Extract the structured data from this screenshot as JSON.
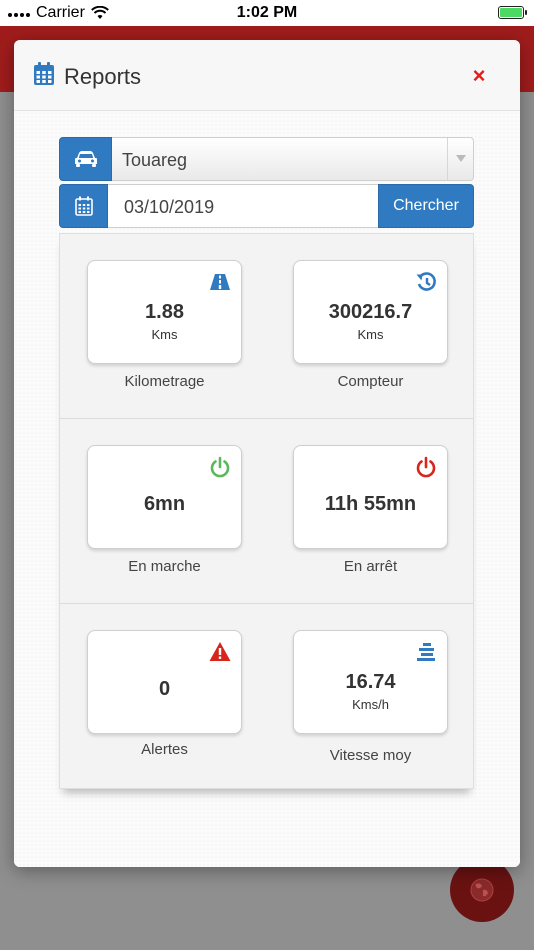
{
  "status_bar": {
    "carrier": "Carrier",
    "time": "1:02 PM"
  },
  "modal": {
    "title": "Reports",
    "close_label": "×"
  },
  "filters": {
    "vehicle_selected": "Touareg",
    "date_value": "03/10/2019",
    "search_label": "Chercher"
  },
  "stats": [
    {
      "value": "1.88",
      "unit": "Kms",
      "caption": "Kilometrage",
      "icon": "road-icon",
      "color": "#2f7ac0"
    },
    {
      "value": "300216.7",
      "unit": "Kms",
      "caption": "Compteur",
      "icon": "history-icon",
      "color": "#2f7ac0"
    },
    {
      "value": "6mn",
      "unit": "",
      "caption": "En marche",
      "icon": "power-on-icon",
      "color": "#5cb85c"
    },
    {
      "value": "11h 55mn",
      "unit": "",
      "caption": "En arrêt",
      "icon": "power-off-icon",
      "color": "#d9261c"
    },
    {
      "value": "0",
      "unit": "",
      "caption": "Alertes",
      "icon": "warning-icon",
      "color": "#d9261c"
    },
    {
      "value": "16.74",
      "unit": "Kms/h",
      "caption": "Vitesse moy",
      "icon": "speed-icon",
      "color": "#2f7ac0"
    }
  ],
  "colors": {
    "primary": "#2f7ac0",
    "danger": "#d9261c",
    "success": "#5cb85c",
    "app_header": "#a01c1c"
  }
}
